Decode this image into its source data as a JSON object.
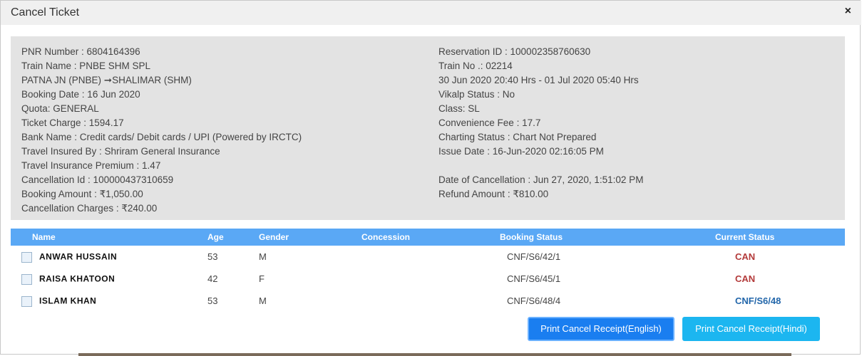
{
  "modal": {
    "title": "Cancel Ticket",
    "close_glyph": "×"
  },
  "ticket": {
    "left": [
      "PNR Number : 6804164396",
      "Train Name : PNBE SHM SPL",
      "PATNA JN (PNBE) ➞SHALIMAR (SHM)",
      "Booking Date : 16 Jun 2020",
      "Quota: GENERAL",
      "Ticket Charge : 1594.17",
      "Bank Name : Credit cards/ Debit cards / UPI (Powered by IRCTC)",
      "Travel Insured By : Shriram General Insurance",
      "Travel Insurance Premium : 1.47",
      "Cancellation Id : 100000437310659",
      "Booking Amount : ₹1,050.00",
      "Cancellation Charges : ₹240.00"
    ],
    "right": [
      "Reservation ID : 100002358760630",
      "Train No .: 02214",
      "30 Jun 2020 20:40 Hrs - 01 Jul 2020 05:40 Hrs",
      "Vikalp Status : No",
      "Class: SL",
      "Convenience Fee : 17.7",
      "Charting Status : Chart Not Prepared",
      "Issue Date : 16-Jun-2020 02:16:05 PM",
      "",
      "Date of Cancellation : Jun 27, 2020, 1:51:02 PM",
      "Refund Amount : ₹810.00"
    ]
  },
  "table": {
    "headers": {
      "name": "Name",
      "age": "Age",
      "gender": "Gender",
      "concession": "Concession",
      "booking_status": "Booking Status",
      "current_status": "Current Status"
    },
    "rows": [
      {
        "name": "ANWAR HUSSAIN",
        "age": "53",
        "gender": "M",
        "concession": "",
        "booking_status": "CNF/S6/42/1",
        "current_status": "CAN"
      },
      {
        "name": "RAISA KHATOON",
        "age": "42",
        "gender": "F",
        "concession": "",
        "booking_status": "CNF/S6/45/1",
        "current_status": "CAN"
      },
      {
        "name": "ISLAM KHAN",
        "age": "53",
        "gender": "M",
        "concession": "",
        "booking_status": "CNF/S6/48/4",
        "current_status": "CNF/S6/48"
      }
    ]
  },
  "buttons": {
    "print_english": "Print Cancel Receipt(English)",
    "print_hindi": "Print Cancel Receipt(Hindi)"
  },
  "colors": {
    "header_bar": "#5aa8f5",
    "status_cancelled": "#b33a3a",
    "status_confirmed": "#2266aa",
    "button_english": "#1a7ef0",
    "button_hindi": "#1cb6f0"
  }
}
